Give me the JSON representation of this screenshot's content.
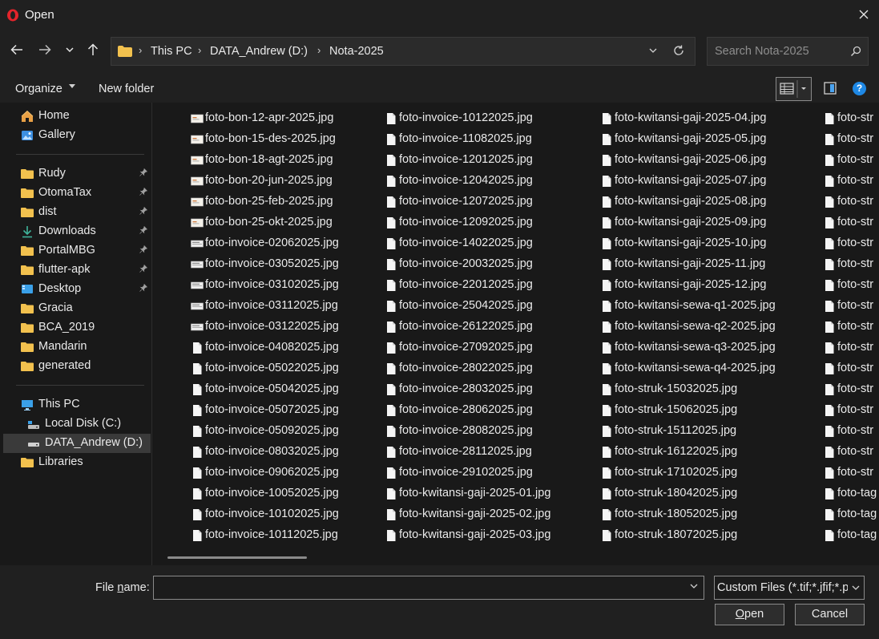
{
  "window": {
    "title": "Open"
  },
  "address": {
    "crumbs": [
      "This PC",
      "DATA_Andrew (D:)",
      "Nota-2025"
    ]
  },
  "search": {
    "placeholder": "Search Nota-2025"
  },
  "toolbar": {
    "organize": "Organize",
    "new_folder": "New folder"
  },
  "sidebar": {
    "quick": [
      {
        "label": "Home",
        "icon": "home-icon"
      },
      {
        "label": "Gallery",
        "icon": "gallery-icon"
      }
    ],
    "pinned": [
      {
        "label": "Rudy",
        "icon": "folder-icon",
        "pinned": true
      },
      {
        "label": "OtomaTax",
        "icon": "folder-icon",
        "pinned": true
      },
      {
        "label": "dist",
        "icon": "folder-icon",
        "pinned": true
      },
      {
        "label": "Downloads",
        "icon": "download-icon",
        "pinned": true
      },
      {
        "label": "PortalMBG",
        "icon": "folder-icon",
        "pinned": true
      },
      {
        "label": "flutter-apk",
        "icon": "folder-icon",
        "pinned": true
      },
      {
        "label": "Desktop",
        "icon": "desktop-icon",
        "pinned": true
      },
      {
        "label": "Gracia",
        "icon": "folder-icon",
        "pinned": false
      },
      {
        "label": "BCA_2019",
        "icon": "folder-icon",
        "pinned": false
      },
      {
        "label": "Mandarin",
        "icon": "folder-icon",
        "pinned": false
      },
      {
        "label": "generated",
        "icon": "folder-icon",
        "pinned": false
      }
    ],
    "devices": [
      {
        "label": "This PC",
        "icon": "pc-icon"
      },
      {
        "label": "Local Disk (C:)",
        "icon": "drive-icon"
      },
      {
        "label": "DATA_Andrew (D:)",
        "icon": "drive-icon",
        "selected": true
      },
      {
        "label": "Libraries",
        "icon": "folder-icon"
      }
    ]
  },
  "files": {
    "col1": [
      {
        "name": "foto-bon-12-apr-2025.jpg",
        "thumb": "receipt"
      },
      {
        "name": "foto-bon-15-des-2025.jpg",
        "thumb": "receipt"
      },
      {
        "name": "foto-bon-18-agt-2025.jpg",
        "thumb": "receipt"
      },
      {
        "name": "foto-bon-20-jun-2025.jpg",
        "thumb": "receipt"
      },
      {
        "name": "foto-bon-25-feb-2025.jpg",
        "thumb": "receipt"
      },
      {
        "name": "foto-bon-25-okt-2025.jpg",
        "thumb": "receipt"
      },
      {
        "name": "foto-invoice-02062025.jpg",
        "thumb": "doc"
      },
      {
        "name": "foto-invoice-03052025.jpg",
        "thumb": "doc"
      },
      {
        "name": "foto-invoice-03102025.jpg",
        "thumb": "doc"
      },
      {
        "name": "foto-invoice-03112025.jpg",
        "thumb": "doc"
      },
      {
        "name": "foto-invoice-03122025.jpg",
        "thumb": "doc"
      },
      {
        "name": "foto-invoice-04082025.jpg",
        "thumb": "page"
      },
      {
        "name": "foto-invoice-05022025.jpg",
        "thumb": "page"
      },
      {
        "name": "foto-invoice-05042025.jpg",
        "thumb": "page"
      },
      {
        "name": "foto-invoice-05072025.jpg",
        "thumb": "page"
      },
      {
        "name": "foto-invoice-05092025.jpg",
        "thumb": "page"
      },
      {
        "name": "foto-invoice-08032025.jpg",
        "thumb": "page"
      },
      {
        "name": "foto-invoice-09062025.jpg",
        "thumb": "page"
      },
      {
        "name": "foto-invoice-10052025.jpg",
        "thumb": "page"
      },
      {
        "name": "foto-invoice-10102025.jpg",
        "thumb": "page"
      },
      {
        "name": "foto-invoice-10112025.jpg",
        "thumb": "page"
      }
    ],
    "col2": [
      "foto-invoice-10122025.jpg",
      "foto-invoice-11082025.jpg",
      "foto-invoice-12012025.jpg",
      "foto-invoice-12042025.jpg",
      "foto-invoice-12072025.jpg",
      "foto-invoice-12092025.jpg",
      "foto-invoice-14022025.jpg",
      "foto-invoice-20032025.jpg",
      "foto-invoice-22012025.jpg",
      "foto-invoice-25042025.jpg",
      "foto-invoice-26122025.jpg",
      "foto-invoice-27092025.jpg",
      "foto-invoice-28022025.jpg",
      "foto-invoice-28032025.jpg",
      "foto-invoice-28062025.jpg",
      "foto-invoice-28082025.jpg",
      "foto-invoice-28112025.jpg",
      "foto-invoice-29102025.jpg",
      "foto-kwitansi-gaji-2025-01.jpg",
      "foto-kwitansi-gaji-2025-02.jpg",
      "foto-kwitansi-gaji-2025-03.jpg"
    ],
    "col3": [
      "foto-kwitansi-gaji-2025-04.jpg",
      "foto-kwitansi-gaji-2025-05.jpg",
      "foto-kwitansi-gaji-2025-06.jpg",
      "foto-kwitansi-gaji-2025-07.jpg",
      "foto-kwitansi-gaji-2025-08.jpg",
      "foto-kwitansi-gaji-2025-09.jpg",
      "foto-kwitansi-gaji-2025-10.jpg",
      "foto-kwitansi-gaji-2025-11.jpg",
      "foto-kwitansi-gaji-2025-12.jpg",
      "foto-kwitansi-sewa-q1-2025.jpg",
      "foto-kwitansi-sewa-q2-2025.jpg",
      "foto-kwitansi-sewa-q3-2025.jpg",
      "foto-kwitansi-sewa-q4-2025.jpg",
      "foto-struk-15032025.jpg",
      "foto-struk-15062025.jpg",
      "foto-struk-15112025.jpg",
      "foto-struk-16122025.jpg",
      "foto-struk-17102025.jpg",
      "foto-struk-18042025.jpg",
      "foto-struk-18052025.jpg",
      "foto-struk-18072025.jpg"
    ],
    "col4": [
      "foto-str",
      "foto-str",
      "foto-str",
      "foto-str",
      "foto-str",
      "foto-str",
      "foto-str",
      "foto-str",
      "foto-str",
      "foto-str",
      "foto-str",
      "foto-str",
      "foto-str",
      "foto-str",
      "foto-str",
      "foto-str",
      "foto-str",
      "foto-str",
      "foto-tag",
      "foto-tag",
      "foto-tag"
    ]
  },
  "bottom": {
    "file_name_label_pre": "File ",
    "file_name_label_ul": "n",
    "file_name_label_post": "ame:",
    "file_name_value": "",
    "filter": "Custom Files (*.tif;*.jfif;*.p",
    "open_ul": "O",
    "open_rest": "pen",
    "cancel": "Cancel"
  },
  "colors": {
    "accent": "#1e88e5",
    "folder": "#f2c14e",
    "background": "#191919"
  }
}
